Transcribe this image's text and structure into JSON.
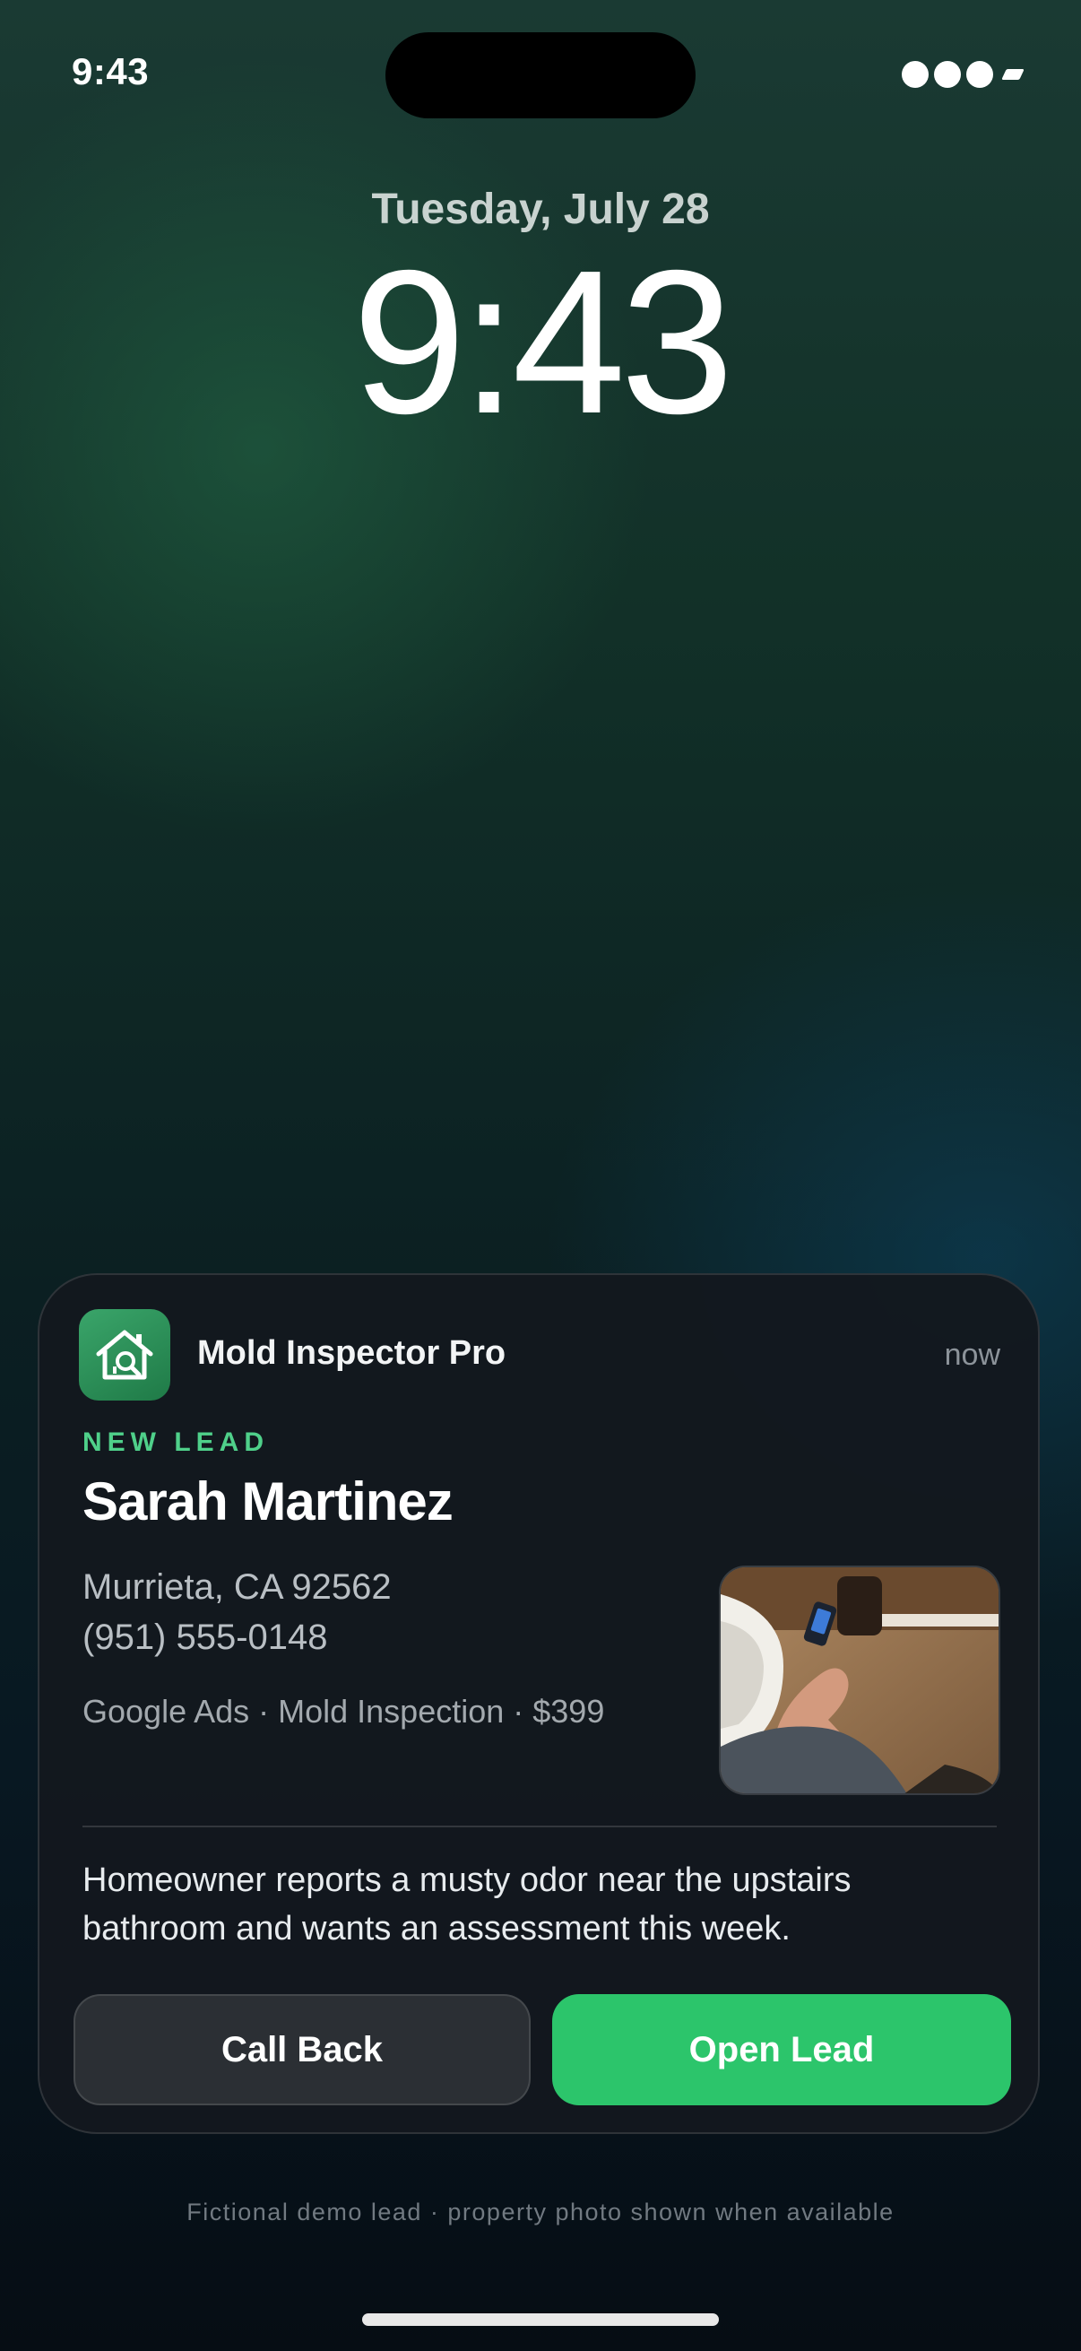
{
  "status_bar": {
    "time": "9:43"
  },
  "lock_screen": {
    "date": "Tuesday, July 28",
    "time": "9:43"
  },
  "notification": {
    "app_name": "Mold Inspector Pro",
    "app_icon": "house-magnifier-icon",
    "time": "now",
    "tag": "NEW LEAD",
    "lead_name": "Sarah Martinez",
    "location": "Murrieta, CA 92562",
    "phone": "(951) 555-0148",
    "meta": "Google Ads · Mold Inspection · $399",
    "message": "Homeowner reports a musty odor near the upstairs bathroom and wants an assessment this week.",
    "actions": {
      "call_back": "Call Back",
      "open_lead": "Open Lead"
    }
  },
  "footnote": "Fictional demo lead · property photo shown when available",
  "colors": {
    "accent_green": "#2cc56b",
    "tag_green": "#4fd08a",
    "card_bg": "#13181e"
  }
}
